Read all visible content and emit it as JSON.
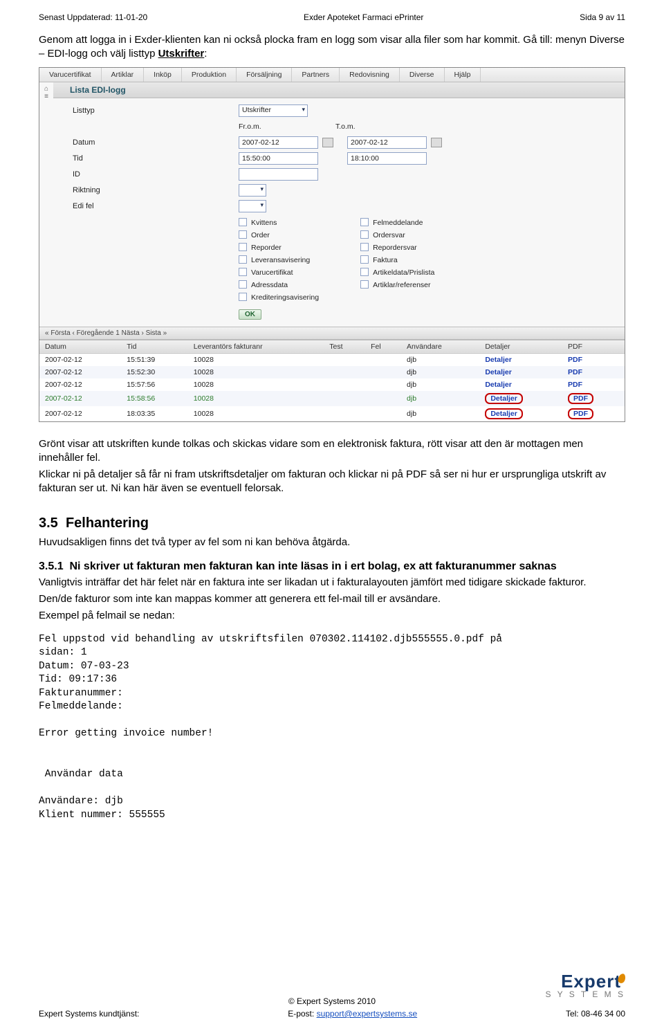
{
  "header": {
    "left": "Senast Uppdaterad: 11-01-20",
    "center": "Exder Apoteket Farmaci ePrinter",
    "right": "Sida 9 av 11"
  },
  "intro": {
    "p1": "Genom att logga in i Exder-klienten kan ni också plocka fram en logg som visar alla filer som har kommit. Gå till: menyn Diverse – EDI-logg och välj listtyp ",
    "p1u": "Utskrifter",
    "p1end": ":"
  },
  "ui": {
    "tabs": [
      "Varucertifikat",
      "Artiklar",
      "Inköp",
      "Produktion",
      "Försäljning",
      "Partners",
      "Redovisning",
      "Diverse",
      "Hjälp"
    ],
    "panelTitle": "Lista EDI-logg",
    "labels": {
      "listtyp": "Listtyp",
      "from": "Fr.o.m.",
      "tom": "T.o.m.",
      "datum": "Datum",
      "tid": "Tid",
      "id": "ID",
      "riktning": "Riktning",
      "edifel": "Edi fel"
    },
    "values": {
      "listtyp": "Utskrifter",
      "datum_from": "2007-02-12",
      "datum_to": "2007-02-12",
      "tid_from": "15:50:00",
      "tid_to": "18:10:00"
    },
    "checks_left": [
      "Kvittens",
      "Order",
      "Reporder",
      "Leveransavisering",
      "Varucertifikat",
      "Adressdata",
      "Krediteringsavisering"
    ],
    "checks_right": [
      "Felmeddelande",
      "Ordersvar",
      "Repordersvar",
      "Faktura",
      "Artikeldata/Prislista",
      "Artiklar/referenser"
    ],
    "ok": "OK",
    "pager": "« Första   ‹ Föregående   1  Nästa ›   Sista »",
    "grid": {
      "headers": [
        "Datum",
        "Tid",
        "Leverantörs fakturanr",
        "Test",
        "Fel",
        "Användare",
        "Detaljer",
        "PDF"
      ],
      "rows": [
        {
          "d": "2007-02-12",
          "t": "15:51:39",
          "f": "10028",
          "u": "djb",
          "det": "Detaljer",
          "pdf": "PDF"
        },
        {
          "d": "2007-02-12",
          "t": "15:52:30",
          "f": "10028",
          "u": "djb",
          "det": "Detaljer",
          "pdf": "PDF"
        },
        {
          "d": "2007-02-12",
          "t": "15:57:56",
          "f": "10028",
          "u": "djb",
          "det": "Detaljer",
          "pdf": "PDF"
        },
        {
          "d": "2007-02-12",
          "t": "15:58:56",
          "f": "10028",
          "u": "djb",
          "det": "Detaljer",
          "pdf": "PDF",
          "green": true,
          "mark": true
        },
        {
          "d": "2007-02-12",
          "t": "18:03:35",
          "f": "10028",
          "u": "djb",
          "det": "Detaljer",
          "pdf": "PDF",
          "mark": true
        }
      ]
    }
  },
  "after": {
    "p1": "Grönt visar att utskriften kunde tolkas och skickas vidare som en elektronisk faktura, rött visar att den är mottagen men innehåller fel.",
    "p2": "Klickar ni på detaljer så får ni fram utskriftsdetaljer om fakturan och klickar ni på PDF så ser ni hur er ursprungliga utskrift av fakturan ser ut. Ni kan här även se eventuell felorsak."
  },
  "sec35": {
    "num": "3.5",
    "title": "Felhantering",
    "p": "Huvudsakligen finns det två typer av fel som ni kan behöva åtgärda."
  },
  "sec351": {
    "num": "3.5.1",
    "title": "Ni skriver ut fakturan men fakturan kan inte läsas in i ert bolag, ex att fakturanummer saknas",
    "p1": "Vanligtvis inträffar det här felet när en faktura inte ser likadan ut i fakturalayouten jämfört med tidigare skickade fakturor.",
    "p2": "Den/de fakturor som inte kan mappas kommer att generera ett fel-mail till er avsändare.",
    "p3": "Exempel på felmail se nedan:"
  },
  "mono": "Fel uppstod vid behandling av utskriftsfilen 070302.114102.djb555555.0.pdf på\nsidan: 1\nDatum: 07-03-23\nTid: 09:17:36\nFakturanummer:\nFelmeddelande:\n\nError getting invoice number!\n\n\n Användar data\n\nAnvändare: djb\nKlient nummer: 555555",
  "footer": {
    "copyright": "© Expert Systems 2010",
    "left": "Expert Systems kundtjänst:",
    "mid_pre": "E-post: ",
    "mid_link": "support@expertsystems.se",
    "right": "Tel: 08-46 34 00",
    "logo_word": "Expert",
    "logo_sub": "S Y S T E M S"
  }
}
